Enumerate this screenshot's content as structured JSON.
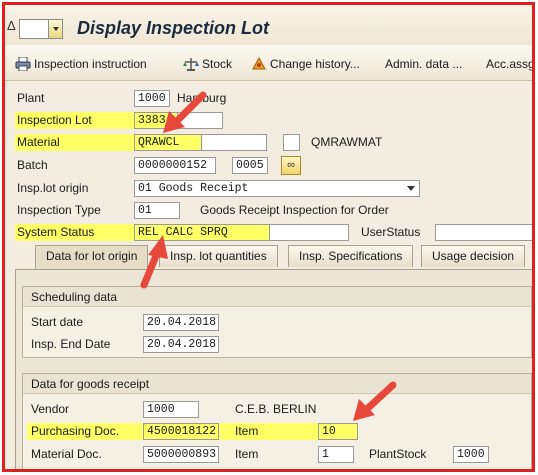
{
  "window": {
    "title": "Display Inspection Lot",
    "edge_glyph": "Δ"
  },
  "toolbar": {
    "items": [
      {
        "label": "Inspection instruction",
        "icon": "printer-icon"
      },
      {
        "label": "Stock",
        "icon": "scale-icon"
      },
      {
        "label": "Change history...",
        "icon": "history-icon"
      },
      {
        "label": "Admin. data ...",
        "icon": ""
      },
      {
        "label": "Acc.assg",
        "icon": ""
      }
    ]
  },
  "header": {
    "plant": {
      "label": "Plant",
      "value": "1000",
      "text": "Hamburg"
    },
    "inspection_lot": {
      "label": "Inspection Lot",
      "value": "3383"
    },
    "material": {
      "label": "Material",
      "value": "QRAWCL",
      "text": "QMRAWMAT"
    },
    "batch": {
      "label": "Batch",
      "value": "0000000152",
      "value2": "0005"
    },
    "insp_lot_origin": {
      "label": "Insp.lot origin",
      "value": "01 Goods Receipt"
    },
    "inspection_type": {
      "label": "Inspection Type",
      "value": "01",
      "text": "Goods Receipt Inspection for Order"
    },
    "system_status": {
      "label": "System Status",
      "value": "REL  CALC SPRQ"
    },
    "user_status": {
      "label": "UserStatus",
      "value": ""
    }
  },
  "tabs": [
    {
      "label": "Data for lot origin",
      "active": true
    },
    {
      "label": "Insp. lot quantities",
      "active": false
    },
    {
      "label": "Insp. Specifications",
      "active": false
    },
    {
      "label": "Usage decision",
      "active": false
    }
  ],
  "scheduling": {
    "title": "Scheduling data",
    "start_date": {
      "label": "Start date",
      "value": "20.04.2018"
    },
    "end_date": {
      "label": "Insp. End Date",
      "value": "20.04.2018"
    }
  },
  "goods_receipt": {
    "title": "Data for goods receipt",
    "vendor": {
      "label": "Vendor",
      "value": "1000",
      "text": "C.E.B. BERLIN"
    },
    "purchasing_doc": {
      "label": "Purchasing Doc.",
      "value": "4500018122",
      "item_label": "Item",
      "item_value": "10"
    },
    "material_doc": {
      "label": "Material Doc.",
      "value": "5000000893",
      "item_label": "Item",
      "item_value": "1",
      "plant_stock_label": "PlantStock",
      "plant_stock_value": "1000"
    }
  },
  "colors": {
    "highlight": "#ffff66",
    "annotation_arrow": "#e8473b",
    "frame": "#e02020"
  }
}
